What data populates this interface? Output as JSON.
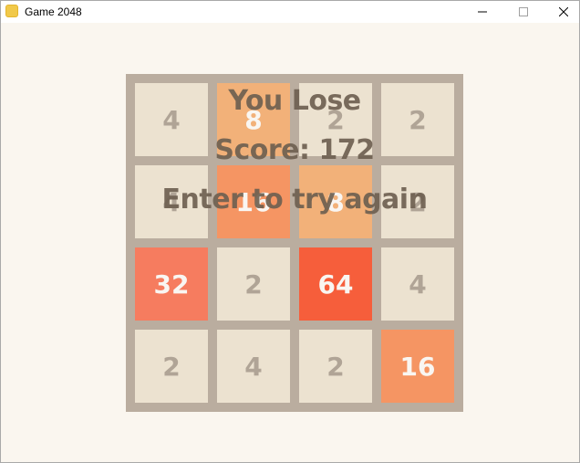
{
  "window": {
    "title": "Game 2048"
  },
  "overlay": {
    "lose_text": "You Lose",
    "score_text": "Score: 172",
    "retry_text": "Enter to try again"
  },
  "board": {
    "grid": [
      [
        "4",
        "8",
        "2",
        "2"
      ],
      [
        "4",
        "16",
        "8",
        "2"
      ],
      [
        "32",
        "2",
        "64",
        "4"
      ],
      [
        "2",
        "4",
        "2",
        "16"
      ]
    ]
  },
  "colors": {
    "board_bg": "#baad9f",
    "page_bg": "#faf6ef",
    "tile_2": "#ece2d0",
    "tile_4": "#ece2d0",
    "tile_8": "#f2b179",
    "tile_16": "#f59563",
    "tile_32": "#f67c5f",
    "tile_64": "#f65e3b",
    "text_dark": "#b0a496",
    "text_light": "#f9f6f2"
  },
  "icons": {
    "app": "game-2048-icon",
    "minimize": "minimize-icon",
    "maximize": "maximize-icon",
    "close": "close-icon"
  }
}
